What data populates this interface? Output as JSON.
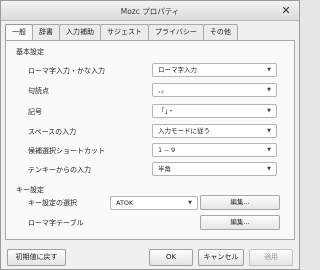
{
  "window": {
    "title": "Mozc プロパティ"
  },
  "tabs": [
    {
      "label": "一般",
      "active": true
    },
    {
      "label": "辞書",
      "active": false
    },
    {
      "label": "入力補助",
      "active": false
    },
    {
      "label": "サジェスト",
      "active": false
    },
    {
      "label": "プライバシー",
      "active": false
    },
    {
      "label": "その他",
      "active": false
    }
  ],
  "basic": {
    "heading": "基本設定",
    "rows": [
      {
        "label": "ローマ字入力・かな入力",
        "value": "ローマ字入力"
      },
      {
        "label": "句読点",
        "value": "、。"
      },
      {
        "label": "記号",
        "value": "「」・"
      },
      {
        "label": "スペースの入力",
        "value": "入力モードに従う"
      },
      {
        "label": "候補選択ショートカット",
        "value": "1 -- 9"
      },
      {
        "label": "テンキーからの入力",
        "value": "半角"
      }
    ]
  },
  "keys": {
    "heading": "キー設定",
    "keymap_label": "キー設定の選択",
    "keymap_value": "ATOK",
    "edit_label": "編集...",
    "romaji_label": "ローマ字テーブル",
    "romaji_edit_label": "編集..."
  },
  "footer": {
    "reset_label": "初期値に戻す",
    "ok_label": "OK",
    "cancel_label": "キャンセル",
    "apply_label": "適用"
  }
}
